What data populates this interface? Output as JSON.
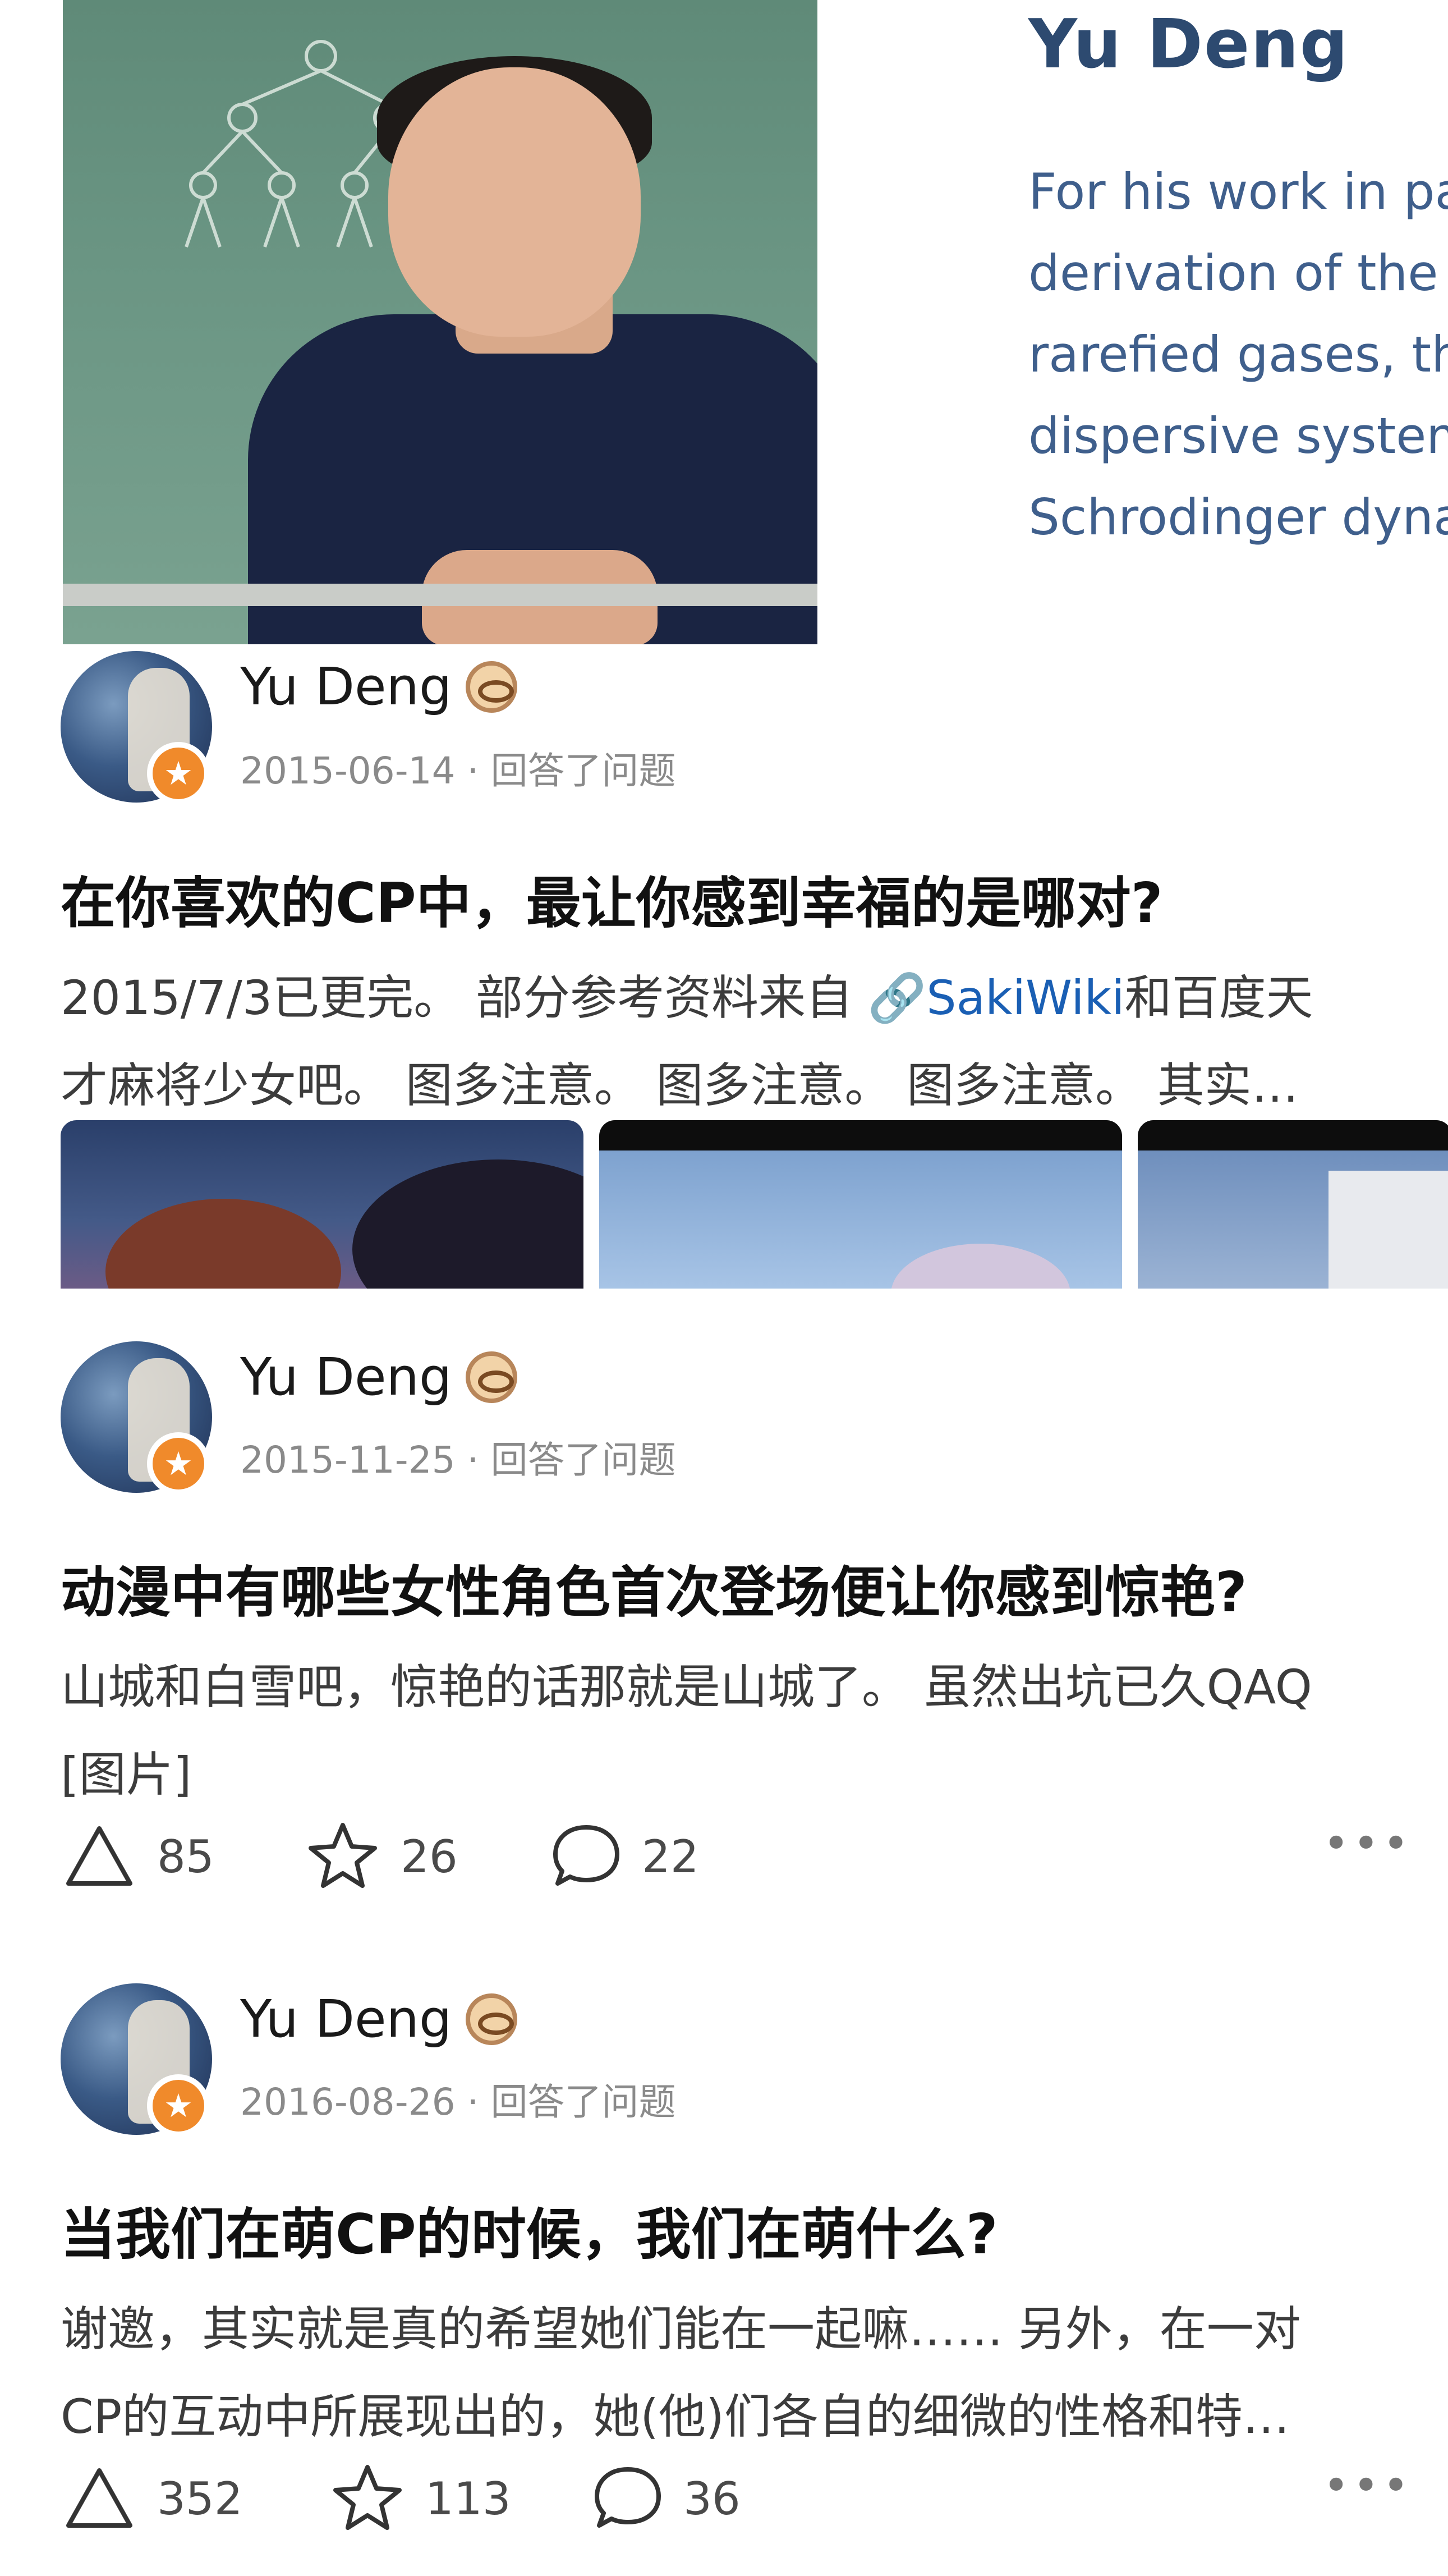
{
  "award_card": {
    "name": "Yu Deng",
    "citation_lines": [
      "For his work in pa",
      "derivation of the",
      "rarefied gases, th",
      "dispersive system",
      "Schrodinger dyna"
    ]
  },
  "posts": [
    {
      "author": "Yu Deng",
      "meta": "2015-06-14 · 回答了问题",
      "question": "在你喜欢的CP中，最让你感到幸福的是哪对?",
      "excerpt_line1_pre": "2015/7/3已更完。 部分参考资料来自 ",
      "excerpt_link": "SakiWiki",
      "excerpt_line1_post": "和百度天",
      "excerpt_line2": "才麻将少女吧。 图多注意。 图多注意。 图多注意。 其实…"
    },
    {
      "author": "Yu Deng",
      "meta": "2015-11-25 · 回答了问题",
      "question": "动漫中有哪些女性角色首次登场便让你感到惊艳?",
      "excerpt_line1": "山城和白雪吧，惊艳的话那就是山城了。 虽然出坑已久QAQ",
      "excerpt_line2": "[图片]",
      "likes": "85",
      "favorites": "26",
      "comments": "22"
    },
    {
      "author": "Yu Deng",
      "meta": "2016-08-26 · 回答了问题",
      "question": "当我们在萌CP的时候，我们在萌什么?",
      "excerpt_line1": "谢邀，其实就是真的希望她们能在一起嘛…… 另外，在一对",
      "excerpt_line2": "CP的互动中所展现出的，她(他)们各自的细微的性格和特…",
      "likes": "352",
      "favorites": "113",
      "comments": "36"
    }
  ],
  "icons": {
    "like": "triangle-upvote-icon",
    "favorite": "star-icon",
    "comment": "speech-bubble-icon",
    "more": "more-dots-icon",
    "verified": "verified-badge-icon"
  },
  "colors": {
    "link": "#1a5fb4",
    "badge": "#f08a2b",
    "award_title": "#2d4a70"
  }
}
